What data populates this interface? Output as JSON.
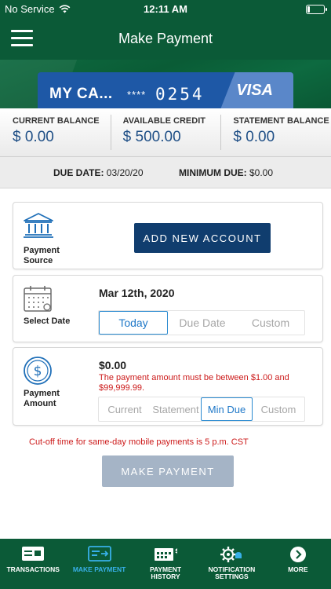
{
  "status": {
    "carrier": "No Service",
    "time": "12:11 AM",
    "battery_level": 0.15
  },
  "header": {
    "title": "Make Payment"
  },
  "card": {
    "name": "MY CA...",
    "mask": "****",
    "last4": "0254",
    "brand": "VISA"
  },
  "balances": [
    {
      "label": "CURRENT BALANCE",
      "value": "$ 0.00"
    },
    {
      "label": "AVAILABLE CREDIT",
      "value": "$ 500.00"
    },
    {
      "label": "STATEMENT BALANCE",
      "value": "$ 0.00"
    }
  ],
  "due": {
    "due_label": "DUE DATE:",
    "due_value": "03/20/20",
    "min_label": "MINIMUM DUE:",
    "min_value": "$0.00"
  },
  "payment_source": {
    "label": "Payment Source",
    "button": "ADD NEW ACCOUNT"
  },
  "select_date": {
    "label": "Select Date",
    "date": "Mar 12th, 2020",
    "options": [
      "Today",
      "Due Date",
      "Custom"
    ]
  },
  "payment_amount": {
    "label": "Payment Amount",
    "value": "$0.00",
    "error": "The payment amount must be between $1.00 and $99,999.99.",
    "options": [
      "Current",
      "Statement",
      "Min Due",
      "Custom"
    ]
  },
  "cutoff": "Cut-off time for same-day mobile payments is 5 p.m. CST",
  "make_payment_button": "MAKE PAYMENT",
  "tabs": [
    {
      "label": "TRANSACTIONS",
      "icon": "transactions-icon"
    },
    {
      "label": "MAKE PAYMENT",
      "icon": "make-payment-icon"
    },
    {
      "label": "PAYMENT HISTORY",
      "icon": "payment-history-icon"
    },
    {
      "label": "NOTIFICATION SETTINGS",
      "icon": "notification-settings-icon"
    },
    {
      "label": "MORE",
      "icon": "more-icon"
    }
  ],
  "colors": {
    "brand_green": "#0b5a37",
    "navy": "#103d6e",
    "active_blue": "#1f78c8",
    "error_red": "#cc1a1a"
  }
}
